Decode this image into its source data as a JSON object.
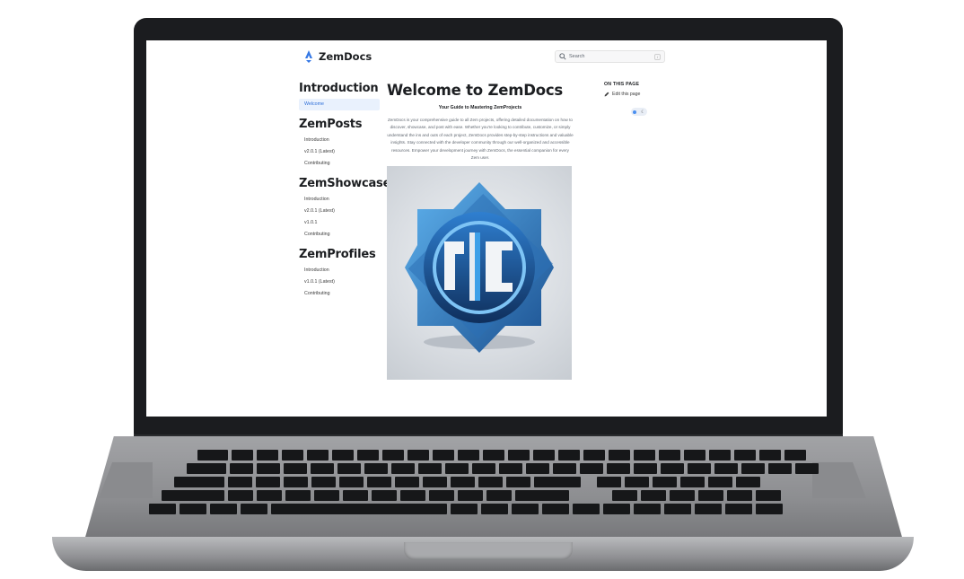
{
  "brand": {
    "name": "ZemDocs",
    "accent": "#3578e5"
  },
  "search": {
    "placeholder": "Search",
    "shortcut": "/"
  },
  "sidebar": {
    "sections": [
      {
        "title": "Introduction",
        "items": [
          {
            "label": "Welcome",
            "active": true
          }
        ]
      },
      {
        "title": "ZemPosts",
        "items": [
          {
            "label": "Introduction"
          },
          {
            "label": "v2.0.1 (Latest)"
          },
          {
            "label": "Contributing"
          }
        ]
      },
      {
        "title": "ZemShowcase",
        "items": [
          {
            "label": "Introduction"
          },
          {
            "label": "v2.0.1 (Latest)"
          },
          {
            "label": "v1.0.1"
          },
          {
            "label": "Contributing"
          }
        ]
      },
      {
        "title": "ZemProfiles",
        "items": [
          {
            "label": "Introduction"
          },
          {
            "label": "v1.0.1 (Latest)"
          },
          {
            "label": "Contributing"
          }
        ]
      }
    ]
  },
  "main": {
    "title": "Welcome to ZemDocs",
    "subtitle": "Your Guide to Mastering ZemProjects",
    "paragraph": "ZemDocs is your comprehensive guide to all Zem projects, offering detailed documentation on how to discover, showcase, and post with ease. Whether you're looking to contribute, customize, or simply understand the ins and outs of each project, ZemDocs provides step-by-step instructions and valuable insights. Stay connected with the developer community through our well-organized and accessible resources. Empower your development journey with ZemDocs, the essential companion for every Zem user."
  },
  "toc": {
    "title": "ON THIS PAGE",
    "edit_label": "Edit this page"
  },
  "theme_toggle": {
    "icons": [
      "sun-icon",
      "moon-icon"
    ]
  }
}
